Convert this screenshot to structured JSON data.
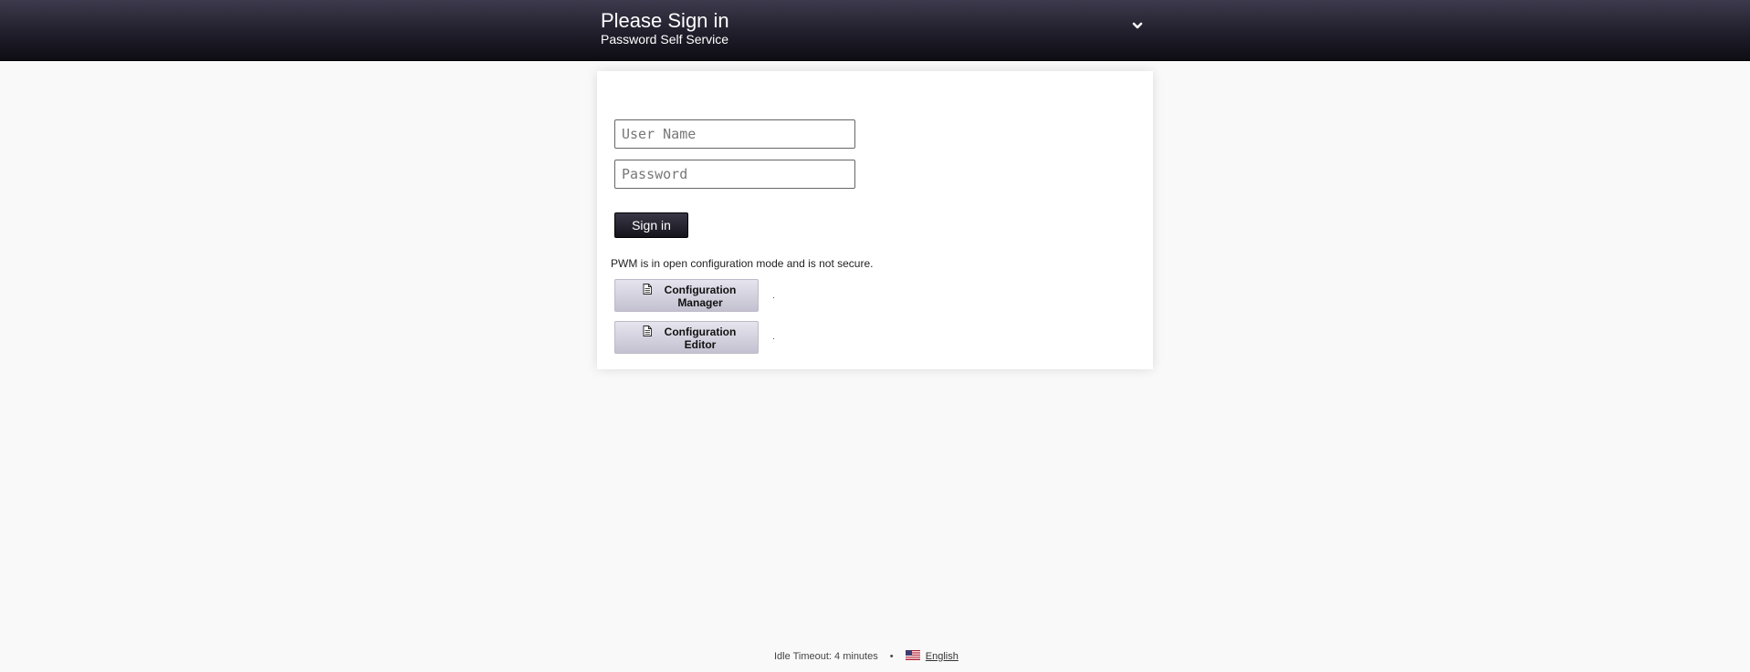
{
  "header": {
    "title": "Please Sign in",
    "subtitle": "Password Self Service",
    "menu_icon": "chevron-down-icon"
  },
  "login_form": {
    "username_placeholder": "User Name",
    "username_value": "",
    "password_placeholder": "Password",
    "password_value": "",
    "signin_label": "Sign in"
  },
  "config": {
    "notice": "PWM is in open configuration mode and is not secure.",
    "manager_label": "Configuration Manager",
    "editor_label": "Configuration Editor",
    "manager_dot": ".",
    "editor_dot": ".",
    "button_icon": "document-icon"
  },
  "footer": {
    "idle_timeout": "Idle Timeout: 4 minutes",
    "separator": "•",
    "language": "English",
    "language_icon": "us-flag-icon"
  },
  "colors": {
    "header_top": "#3d3a4d",
    "header_bottom": "#0e0d14",
    "page_bg": "#f9f9f9",
    "panel_bg": "#ffffff",
    "signin_bg": "#1e1c28",
    "config_btn_bg": "#d3d0de"
  }
}
